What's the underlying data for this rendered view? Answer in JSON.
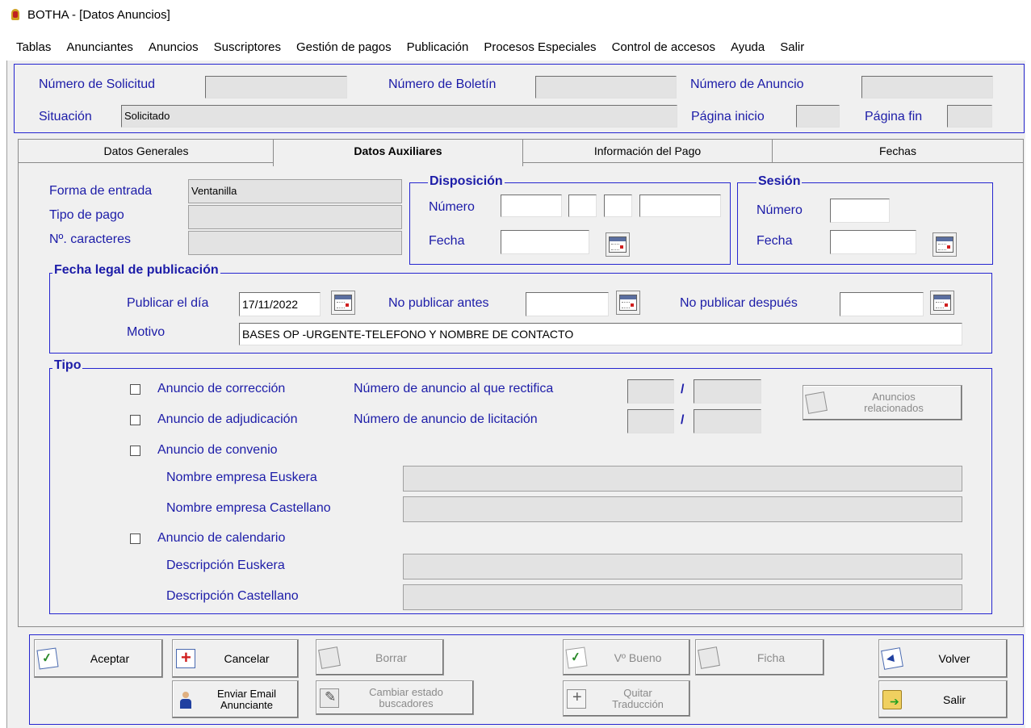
{
  "window": {
    "title": "BOTHA - [Datos Anuncios]"
  },
  "menu": [
    "Tablas",
    "Anunciantes",
    "Anuncios",
    "Suscriptores",
    "Gestión de pagos",
    "Publicación",
    "Procesos Especiales",
    "Control de accesos",
    "Ayuda",
    "Salir"
  ],
  "header": {
    "solicitud_label": "Número de Solicitud",
    "solicitud_value": "",
    "boletin_label": "Número de Boletín",
    "boletin_value": "",
    "anuncio_label": "Número de Anuncio",
    "anuncio_value": "",
    "situacion_label": "Situación",
    "situacion_value": "Solicitado",
    "pagina_inicio_label": "Página inicio",
    "pagina_inicio_value": "",
    "pagina_fin_label": "Página fin",
    "pagina_fin_value": ""
  },
  "tabs": [
    "Datos Generales",
    "Datos Auxiliares",
    "Información del Pago",
    "Fechas"
  ],
  "active_tab": "Datos Auxiliares",
  "aux": {
    "forma_label": "Forma de entrada",
    "forma_value": "Ventanilla",
    "tipo_pago_label": "Tipo de pago",
    "tipo_pago_value": "",
    "caracteres_label": "Nº. caracteres",
    "caracteres_value": "",
    "disposicion": {
      "title": "Disposición",
      "numero_label": "Número",
      "fecha_label": "Fecha"
    },
    "sesion": {
      "title": "Sesión",
      "numero_label": "Número",
      "fecha_label": "Fecha"
    }
  },
  "fecha_legal": {
    "title": "Fecha legal de publicación",
    "publicar_label": "Publicar el día",
    "publicar_value": "17/11/2022",
    "antes_label": "No publicar antes",
    "antes_value": "",
    "despues_label": "No publicar después",
    "despues_value": "",
    "motivo_label": "Motivo",
    "motivo_value": "BASES OP -URGENTE-TELEFONO Y NOMBRE DE CONTACTO"
  },
  "tipo": {
    "title": "Tipo",
    "correccion": "Anuncio de corrección",
    "rectifica_label": "Número de anuncio al que rectifica",
    "adjudicacion": "Anuncio de adjudicación",
    "licitacion_label": "Número de anuncio de licitación",
    "slash": "/",
    "convenio": "Anuncio de convenio",
    "empresa_eus_label": "Nombre empresa Euskera",
    "empresa_cas_label": "Nombre empresa Castellano",
    "calendario": "Anuncio de calendario",
    "desc_eus_label": "Descripción Euskera",
    "desc_cas_label": "Descripción Castellano",
    "relacionados_line1": "Anuncios",
    "relacionados_line2": "relacionados"
  },
  "buttons": {
    "aceptar": "Aceptar",
    "cancelar": "Cancelar",
    "borrar": "Borrar",
    "vobueno": "Vº Bueno",
    "ficha": "Ficha",
    "volver": "Volver",
    "email_line1": "Enviar Email",
    "email_line2": "Anunciante",
    "cambiar_line1": "Cambiar estado",
    "cambiar_line2": "buscadores",
    "quitar_line1": "Quitar",
    "quitar_line2": "Traducción",
    "salir": "Salir"
  }
}
